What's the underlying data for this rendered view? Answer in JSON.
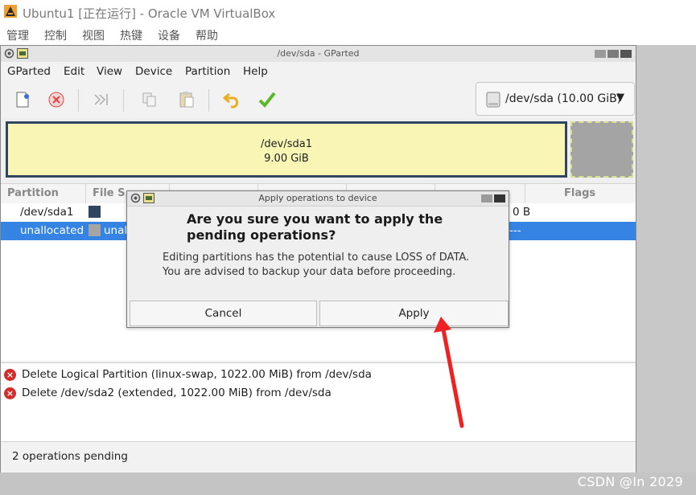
{
  "host": {
    "title": "Ubuntu1 [正在运行] - Oracle VM VirtualBox",
    "menu": [
      "管理",
      "控制",
      "视图",
      "热键",
      "设备",
      "帮助"
    ],
    "watermark": "CSDN @In 2029"
  },
  "gparted": {
    "title": "/dev/sda - GParted",
    "menu": [
      "GParted",
      "Edit",
      "View",
      "Device",
      "Partition",
      "Help"
    ],
    "device_selector": "/dev/sda (10.00 GiB)",
    "map": {
      "partition": "/dev/sda1",
      "size": "9.00 GiB"
    },
    "columns": [
      "Partition",
      "File S",
      "Flags"
    ],
    "rows": [
      {
        "partition": "/dev/sda1",
        "fs_color": "#2e4660",
        "tail": "0 B"
      },
      {
        "partition": "unallocated",
        "fs_color": "#a4a4a4",
        "fs_label": "unal",
        "tail": "---"
      }
    ],
    "operations": [
      "Delete Logical Partition (linux-swap, 1022.00 MiB) from /dev/sda",
      "Delete /dev/sda2 (extended, 1022.00 MiB) from /dev/sda"
    ],
    "status": "2 operations pending"
  },
  "dialog": {
    "title": "Apply operations to device",
    "heading": "Are you sure you want to apply the pending operations?",
    "message_line1": "Editing partitions has the potential to cause LOSS of DATA.",
    "message_line2": "You are advised to backup your data before proceeding.",
    "cancel_label": "Cancel",
    "apply_label": "Apply"
  },
  "colors": {
    "selection": "#3584e4",
    "annotation_arrow": "#ee2222"
  }
}
